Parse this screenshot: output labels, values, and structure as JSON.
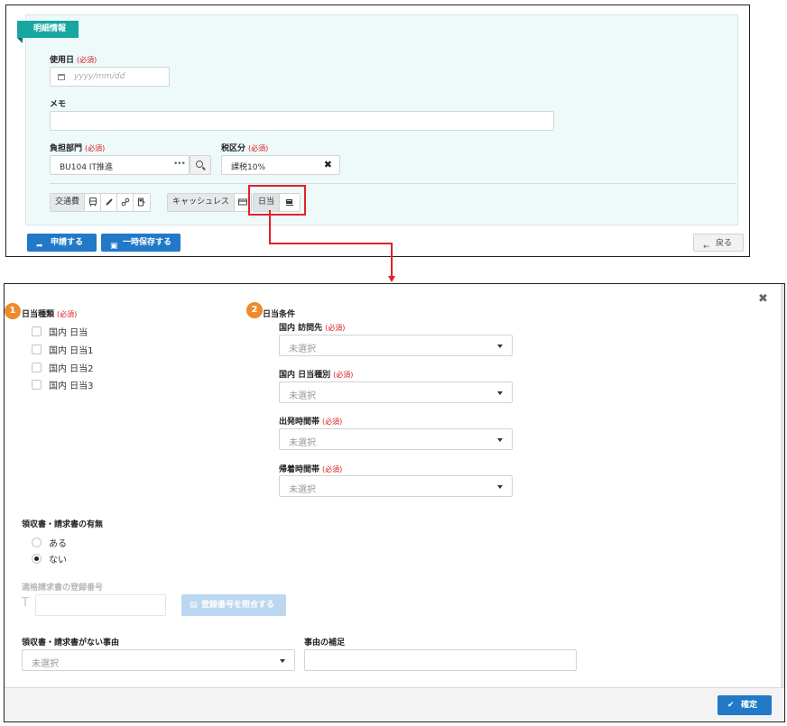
{
  "detail": {
    "tag": "明細情報",
    "use_date": {
      "label": "使用日",
      "required": "(必須)",
      "placeholder": "yyyy/mm/dd"
    },
    "memo": {
      "label": "メモ",
      "value": ""
    },
    "department": {
      "label": "負担部門",
      "required": "(必須)",
      "value": "BU104 IT推進",
      "more": "•••"
    },
    "tax": {
      "label": "税区分",
      "required": "(必須)",
      "value": "課税10%",
      "clear": "✖"
    },
    "toolbar": {
      "transport_label": "交通費",
      "cashless_label": "キャッシュレス",
      "daily_label": "日当"
    }
  },
  "actions": {
    "apply": "申請する",
    "save": "一時保存する",
    "back": "戻る"
  },
  "dialog": {
    "close": "✖",
    "badge1": "1",
    "badge2": "2",
    "daily_type": {
      "heading": "日当種類",
      "required": "(必須)",
      "options": [
        "国内 日当",
        "国内 日当1",
        "国内 日当2",
        "国内 日当3"
      ]
    },
    "daily_condition": {
      "heading": "日当条件",
      "fields": [
        {
          "label": "国内 訪問先",
          "required": "(必須)",
          "value": "未選択"
        },
        {
          "label": "国内 日当種別",
          "required": "(必須)",
          "value": "未選択"
        },
        {
          "label": "出発時間帯",
          "required": "(必須)",
          "value": "未選択"
        },
        {
          "label": "帰着時間帯",
          "required": "(必須)",
          "value": "未選択"
        }
      ]
    },
    "receipt": {
      "heading": "領収書・請求書の有無",
      "options": [
        {
          "label": "ある",
          "selected": false
        },
        {
          "label": "ない",
          "selected": true
        }
      ]
    },
    "registration": {
      "heading": "適格請求書の登録番号",
      "prefix": "T",
      "value": "",
      "verify_button": "登録番号を照合する"
    },
    "no_receipt_reason": {
      "label": "領収書・請求書がない事由",
      "value": "未選択"
    },
    "reason_note": {
      "label": "事由の補足",
      "value": ""
    },
    "confirm": "確定"
  },
  "colors": {
    "accent_teal": "#17a6a0",
    "primary_blue": "#2179c7",
    "highlight_red": "#e2202a",
    "badge_orange": "#ee8a2d",
    "required_red": "#d6191f"
  }
}
